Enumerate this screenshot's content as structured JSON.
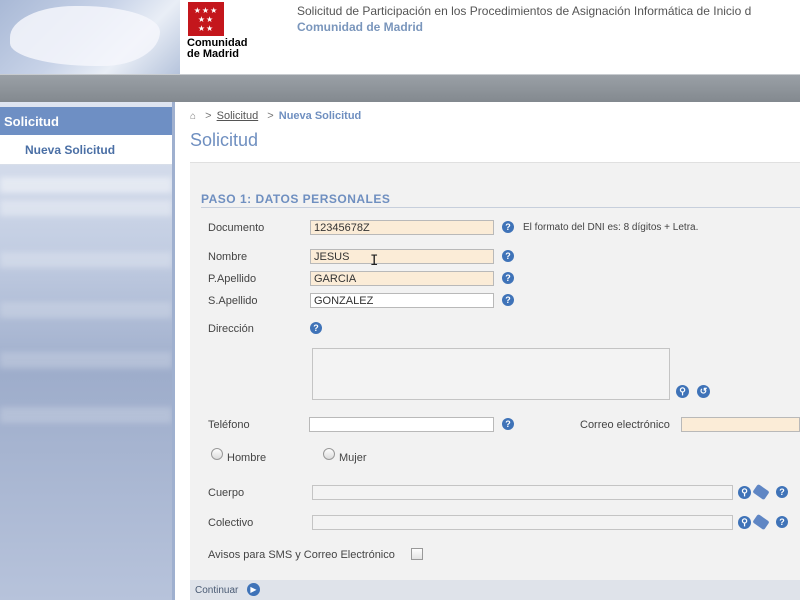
{
  "header": {
    "logo_text": "Comunidad\nde Madrid",
    "logo_stars": "★★★\n★★\n★★",
    "title": "Solicitud de Participación en los Procedimientos de Asignación Informática de Inicio d",
    "subtitle": "Comunidad de Madrid"
  },
  "sidebar": {
    "header": "Solicitud",
    "items": [
      {
        "label": "Nueva Solicitud"
      }
    ]
  },
  "breadcrumb": {
    "home_icon": "home-icon",
    "sep1": ">",
    "link": "Solicitud",
    "sep2": ">",
    "current": "Nueva Solicitud"
  },
  "page_title": "Solicitud",
  "form": {
    "step_title": "PASO 1: DATOS PERSONALES",
    "documento": {
      "label": "Documento",
      "value": "12345678Z",
      "hint": "El formato del DNI es: 8 dígitos + Letra."
    },
    "nombre": {
      "label": "Nombre",
      "value": "JESUS"
    },
    "apellido1": {
      "label": "P.Apellido",
      "value": "GARCIA"
    },
    "apellido2": {
      "label": "S.Apellido",
      "value": "GONZALEZ"
    },
    "direccion": {
      "label": "Dirección",
      "value": ""
    },
    "telefono": {
      "label": "Teléfono",
      "value": ""
    },
    "correo": {
      "label": "Correo electrónico",
      "value": ""
    },
    "sexo": {
      "options": [
        "Hombre",
        "Mujer"
      ],
      "selected": null
    },
    "cuerpo": {
      "label": "Cuerpo",
      "value": ""
    },
    "colectivo": {
      "label": "Colectivo",
      "value": ""
    },
    "avisos": {
      "label": "Avisos para SMS y Correo Electrónico",
      "checked": false
    },
    "help_glyph": "?"
  },
  "footer": {
    "continue_label": "Continuar",
    "continue_glyph": "▶"
  },
  "colors": {
    "accent": "#6f8fc0",
    "required_bg": "#fbecd7",
    "help_icon": "#3f73b8",
    "brand_red": "#c4161c"
  }
}
